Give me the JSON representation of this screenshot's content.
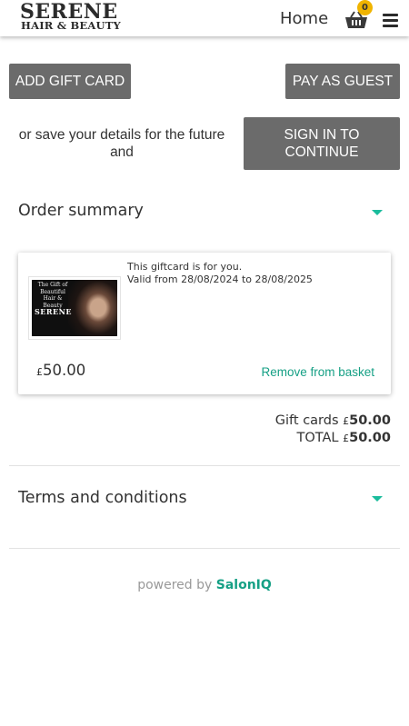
{
  "header": {
    "logo_main": "SERENE",
    "logo_sub": "HAIR & BEAUTY",
    "home_label": "Home",
    "basket_count": "0",
    "accent_color": "#f0b400"
  },
  "actions": {
    "add_gift_card": "ADD GIFT CARD",
    "pay_as_guest": "PAY AS GUEST",
    "save_details_text": "or save your details for the future and",
    "sign_in_line1": "SIGN IN TO",
    "sign_in_line2": "CONTINUE"
  },
  "order_summary": {
    "title": "Order summary",
    "item": {
      "image_text": "The Gift of Beautiful Hair & Beauty",
      "image_brand": "SERENE",
      "recipient": "This giftcard is for you.",
      "validity": "Valid from 28/08/2024 to 28/08/2025",
      "currency": "£",
      "price": "50.00",
      "remove_label": "Remove from basket"
    },
    "totals": {
      "gift_cards_label": "Gift cards",
      "gift_cards_currency": "£",
      "gift_cards_value": "50.00",
      "total_label": "TOTAL",
      "total_currency": "£",
      "total_value": "50.00"
    }
  },
  "terms": {
    "title": "Terms and conditions"
  },
  "footer": {
    "powered_by": "powered by",
    "brand": "SalonIQ",
    "brand_color": "#16a085"
  },
  "icons": {
    "basket": "basket-icon",
    "menu": "hamburger-menu-icon",
    "caret": "caret-down-icon"
  }
}
